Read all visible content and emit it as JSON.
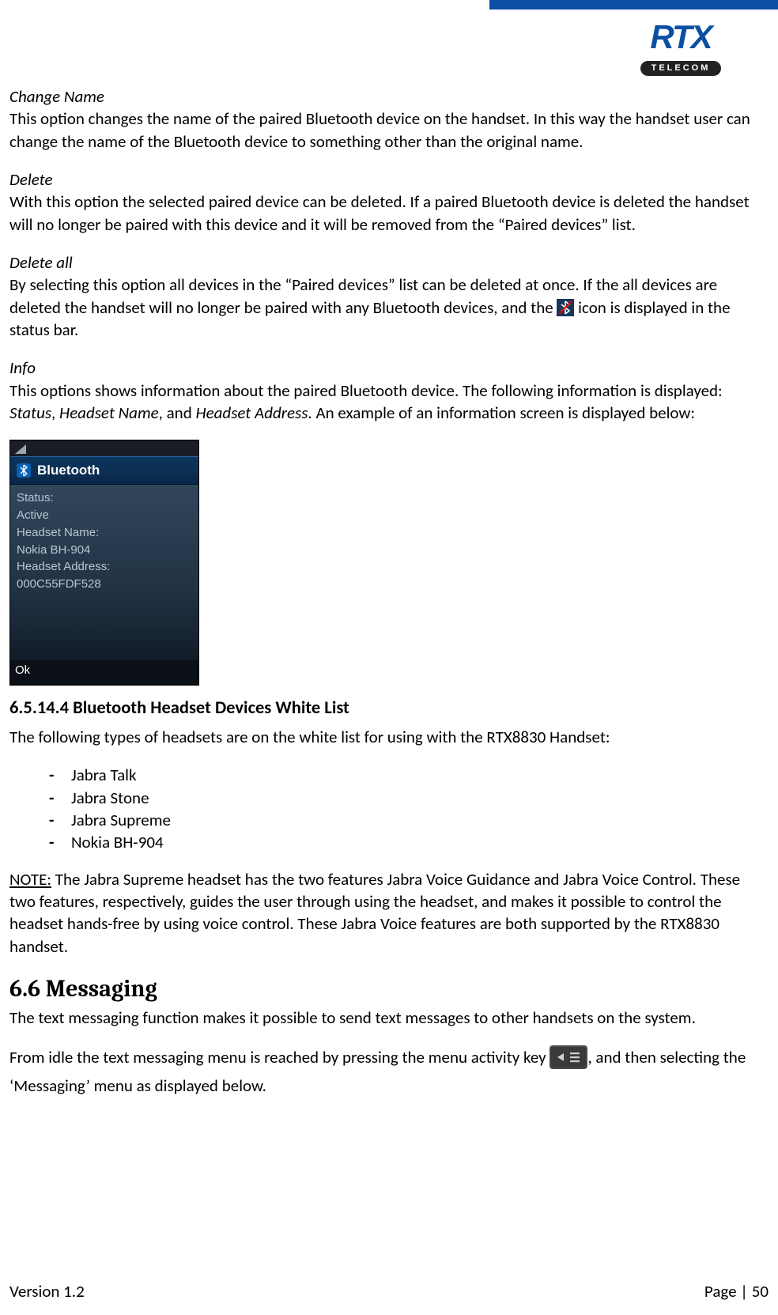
{
  "logo": {
    "main": "RTX",
    "sub": "TELECOM"
  },
  "sections": {
    "change_name": {
      "title": "Change Name",
      "body": "This option changes the name of the paired Bluetooth device on the handset. In this way the handset user can change the name of the Bluetooth device to something other than the original name."
    },
    "delete": {
      "title": "Delete",
      "body": "With this option the selected paired device can be deleted. If a paired Bluetooth device is deleted the handset will no longer be paired with this device and it will be removed from the “Paired devices” list."
    },
    "delete_all": {
      "title": "Delete all",
      "body_before": "By selecting this option all devices in the “Paired devices” list can be deleted at once. If the all devices are deleted the handset will no longer be paired with any Bluetooth devices, and the ",
      "body_after": " icon is displayed in the status bar."
    },
    "info": {
      "title": "Info",
      "body_before": "This options shows information about the paired Bluetooth device. The following information is displayed: ",
      "status": "Status",
      "sep1": ", ",
      "hname": "Headset Name",
      "sep2": ", and ",
      "haddr": "Headset Address",
      "body_after": ". An example of an information screen is displayed below:"
    }
  },
  "bt_shot": {
    "header": "Bluetooth",
    "lines": {
      "l1": "Status:",
      "l2": "Active",
      "l3": "Headset Name:",
      "l4": "Nokia BH-904",
      "l5": "Headset Address:",
      "l6": "000C55FDF528"
    },
    "ok": "Ok"
  },
  "whitelist": {
    "heading": "6.5.14.4 Bluetooth Headset Devices White List",
    "intro": "The following types of headsets are on the white list for using with the RTX8830 Handset:",
    "items": [
      "Jabra Talk",
      "Jabra Stone",
      "Jabra Supreme",
      "Nokia BH-904"
    ],
    "note_label": "NOTE:",
    "note_body": " The Jabra Supreme headset has the two features Jabra Voice Guidance and Jabra Voice Control. These two features, respectively, guides the user through using the headset, and makes it possible to control the headset hands-free by using voice control. These Jabra Voice features are both supported by the RTX8830 handset."
  },
  "messaging": {
    "heading": "6.6 Messaging",
    "p1": "The text messaging function makes it possible to send text messages to other handsets on the system.",
    "p2_before": "From idle the text messaging menu is reached by pressing the menu activity key ",
    "p2_after": ", and then selecting the ‘Messaging’ menu as displayed below."
  },
  "footer": {
    "version": "Version 1.2",
    "page": "Page | 50"
  }
}
